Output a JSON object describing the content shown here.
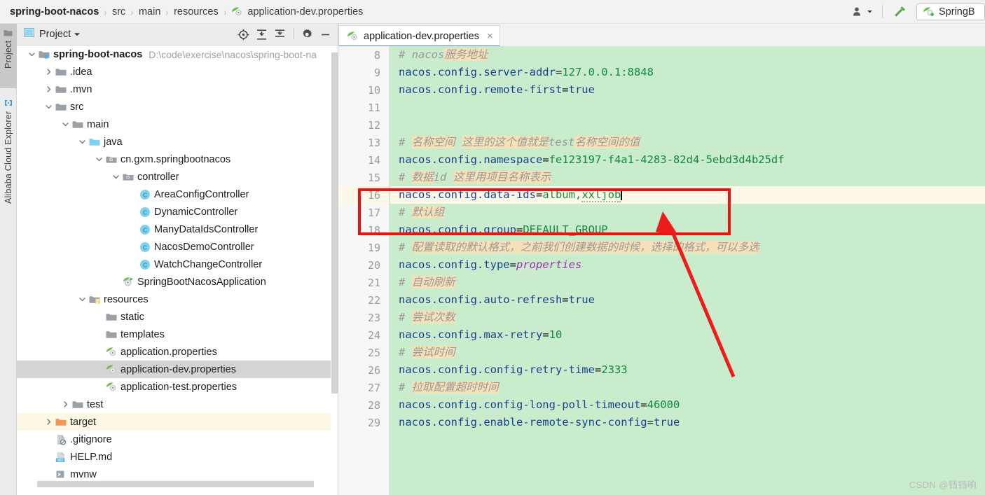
{
  "breadcrumb": {
    "items": [
      "spring-boot-nacos",
      "src",
      "main",
      "resources"
    ],
    "file": "application-dev.properties",
    "separator": "›"
  },
  "navbar_right": {
    "user_icon": "user-silhouette-icon",
    "dropdown_arrow": "chevron-down-icon",
    "build_icon": "hammer-icon",
    "run_config_label": "SpringB"
  },
  "toolstrip": {
    "tabs": [
      {
        "label": "Project",
        "icon": "folder-icon",
        "active": true
      },
      {
        "label": "Alibaba Cloud Explorer",
        "icon": "cloud-link-icon",
        "active": false
      }
    ]
  },
  "project_panel": {
    "title": "Project",
    "title_icon": "project-view-icon",
    "dropdown_icon": "chevron-down-icon",
    "actions": [
      {
        "name": "locate-icon",
        "title": "Select Opened File"
      },
      {
        "name": "expand-all-icon",
        "title": "Expand All"
      },
      {
        "name": "collapse-all-icon",
        "title": "Collapse All"
      },
      {
        "name": "gear-icon",
        "title": "Settings"
      },
      {
        "name": "minimize-icon",
        "title": "Hide"
      }
    ],
    "tree": [
      {
        "depth": 0,
        "twist": "down",
        "icon": "module-folder",
        "label": "spring-boot-nacos",
        "bold": true,
        "path": "D:\\code\\exercise\\nacos\\spring-boot-na"
      },
      {
        "depth": 1,
        "twist": "right",
        "icon": "folder",
        "label": ".idea"
      },
      {
        "depth": 1,
        "twist": "right",
        "icon": "folder",
        "label": ".mvn"
      },
      {
        "depth": 1,
        "twist": "down",
        "icon": "folder",
        "label": "src"
      },
      {
        "depth": 2,
        "twist": "down",
        "icon": "folder",
        "label": "main"
      },
      {
        "depth": 3,
        "twist": "down",
        "icon": "source-folder",
        "label": "java"
      },
      {
        "depth": 4,
        "twist": "down",
        "icon": "package",
        "label": "cn.gxm.springbootnacos"
      },
      {
        "depth": 5,
        "twist": "down",
        "icon": "package",
        "label": "controller"
      },
      {
        "depth": 6,
        "twist": "none",
        "icon": "class",
        "label": "AreaConfigController"
      },
      {
        "depth": 6,
        "twist": "none",
        "icon": "class",
        "label": "DynamicController"
      },
      {
        "depth": 6,
        "twist": "none",
        "icon": "class",
        "label": "ManyDataIdsController"
      },
      {
        "depth": 6,
        "twist": "none",
        "icon": "class",
        "label": "NacosDemoController"
      },
      {
        "depth": 6,
        "twist": "none",
        "icon": "class",
        "label": "WatchChangeController"
      },
      {
        "depth": 5,
        "twist": "none",
        "icon": "spring-class",
        "label": "SpringBootNacosApplication"
      },
      {
        "depth": 3,
        "twist": "down",
        "icon": "resource-folder",
        "label": "resources"
      },
      {
        "depth": 4,
        "twist": "none",
        "icon": "folder",
        "label": "static"
      },
      {
        "depth": 4,
        "twist": "none",
        "icon": "folder",
        "label": "templates"
      },
      {
        "depth": 4,
        "twist": "none",
        "icon": "nacos-file",
        "label": "application.properties"
      },
      {
        "depth": 4,
        "twist": "none",
        "icon": "nacos-file",
        "label": "application-dev.properties",
        "state": "sel"
      },
      {
        "depth": 4,
        "twist": "none",
        "icon": "nacos-file",
        "label": "application-test.properties"
      },
      {
        "depth": 2,
        "twist": "right",
        "icon": "folder",
        "label": "test"
      },
      {
        "depth": 1,
        "twist": "right",
        "icon": "target-folder",
        "label": "target",
        "state": "hl"
      },
      {
        "depth": 1,
        "twist": "none",
        "icon": "gitignore",
        "label": ".gitignore"
      },
      {
        "depth": 1,
        "twist": "none",
        "icon": "markdown",
        "label": "HELP.md"
      },
      {
        "depth": 1,
        "twist": "none",
        "icon": "shell",
        "label": "mvnw"
      }
    ]
  },
  "editor": {
    "tab": {
      "label": "application-dev.properties",
      "icon": "nacos-file",
      "close": "×"
    },
    "current_line": 16,
    "caret_line": 16,
    "lines": [
      {
        "n": 8,
        "segments": [
          {
            "t": "# ",
            "c": "cmt"
          },
          {
            "t": "nacos",
            "c": "cmt"
          },
          {
            "t": "服务地址",
            "c": "cmt cmt-hl"
          }
        ]
      },
      {
        "n": 9,
        "segments": [
          {
            "t": "nacos.config.server-addr",
            "c": "k"
          },
          {
            "t": "=",
            "c": "eq"
          },
          {
            "t": "127.0.0.1:8848",
            "c": "v"
          }
        ]
      },
      {
        "n": 10,
        "segments": [
          {
            "t": "nacos.config.remote-first",
            "c": "k"
          },
          {
            "t": "=",
            "c": "eq"
          },
          {
            "t": "true",
            "c": "k"
          }
        ]
      },
      {
        "n": 11,
        "segments": []
      },
      {
        "n": 12,
        "segments": []
      },
      {
        "n": 13,
        "segments": [
          {
            "t": "# ",
            "c": "cmt"
          },
          {
            "t": "名称空间",
            "c": "cmt cmt-hl"
          },
          {
            "t": " ",
            "c": "cmt"
          },
          {
            "t": "这里的这个值就是",
            "c": "cmt cmt-hl"
          },
          {
            "t": "test",
            "c": "cmt"
          },
          {
            "t": "名称空间的值",
            "c": "cmt cmt-hl"
          }
        ]
      },
      {
        "n": 14,
        "segments": [
          {
            "t": "nacos.config.namespace",
            "c": "k"
          },
          {
            "t": "=",
            "c": "eq"
          },
          {
            "t": "fe123197-f4a1-4283-82d4-5ebd3d4b25df",
            "c": "v"
          }
        ]
      },
      {
        "n": 15,
        "segments": [
          {
            "t": "# ",
            "c": "cmt"
          },
          {
            "t": "数据",
            "c": "cmt cmt-hl"
          },
          {
            "t": "id",
            "c": "cmt"
          },
          {
            "t": " ",
            "c": "cmt"
          },
          {
            "t": "这里用项目名称表示",
            "c": "cmt cmt-hl"
          }
        ]
      },
      {
        "n": 16,
        "segments": [
          {
            "t": "nacos.config.data-ids",
            "c": "k"
          },
          {
            "t": "=",
            "c": "eq"
          },
          {
            "t": "album,",
            "c": "v"
          },
          {
            "t": "xxljob",
            "c": "v squig"
          }
        ],
        "caret": true
      },
      {
        "n": 17,
        "segments": [
          {
            "t": "# ",
            "c": "cmt"
          },
          {
            "t": "默认组",
            "c": "cmt cmt-hl"
          }
        ]
      },
      {
        "n": 18,
        "segments": [
          {
            "t": "nacos.config.group",
            "c": "k"
          },
          {
            "t": "=",
            "c": "eq"
          },
          {
            "t": "DEFAULT_GROUP",
            "c": "v"
          }
        ]
      },
      {
        "n": 19,
        "segments": [
          {
            "t": "# ",
            "c": "cmt"
          },
          {
            "t": "配置读取的默认格式，之前我们创建数据的时候，选择的格式，可以多选",
            "c": "cmt cmt-hl"
          }
        ]
      },
      {
        "n": 20,
        "segments": [
          {
            "t": "nacos.config.type",
            "c": "k"
          },
          {
            "t": "=",
            "c": "eq"
          },
          {
            "t": "properties",
            "c": "vprop"
          }
        ]
      },
      {
        "n": 21,
        "segments": [
          {
            "t": "# ",
            "c": "cmt"
          },
          {
            "t": "自动刷新",
            "c": "cmt cmt-hl"
          }
        ]
      },
      {
        "n": 22,
        "segments": [
          {
            "t": "nacos.config.auto-refresh",
            "c": "k"
          },
          {
            "t": "=",
            "c": "eq"
          },
          {
            "t": "true",
            "c": "k"
          }
        ]
      },
      {
        "n": 23,
        "segments": [
          {
            "t": "# ",
            "c": "cmt"
          },
          {
            "t": "尝试次数",
            "c": "cmt cmt-hl"
          }
        ]
      },
      {
        "n": 24,
        "segments": [
          {
            "t": "nacos.config.max-retry",
            "c": "k"
          },
          {
            "t": "=",
            "c": "eq"
          },
          {
            "t": "10",
            "c": "v"
          }
        ]
      },
      {
        "n": 25,
        "segments": [
          {
            "t": "# ",
            "c": "cmt"
          },
          {
            "t": "尝试时间",
            "c": "cmt cmt-hl"
          }
        ]
      },
      {
        "n": 26,
        "segments": [
          {
            "t": "nacos.config.config-retry-time",
            "c": "k"
          },
          {
            "t": "=",
            "c": "eq"
          },
          {
            "t": "2333",
            "c": "v"
          }
        ]
      },
      {
        "n": 27,
        "segments": [
          {
            "t": "# ",
            "c": "cmt"
          },
          {
            "t": "拉取配置超时时间",
            "c": "cmt cmt-hl"
          }
        ]
      },
      {
        "n": 28,
        "segments": [
          {
            "t": "nacos.config.config-long-poll-timeout",
            "c": "k"
          },
          {
            "t": "=",
            "c": "eq"
          },
          {
            "t": "46000",
            "c": "v"
          }
        ]
      },
      {
        "n": 29,
        "segments": [
          {
            "t": "nacos.config.enable-remote-sync-config",
            "c": "k"
          },
          {
            "t": "=",
            "c": "eq"
          },
          {
            "t": "true",
            "c": "k"
          }
        ]
      }
    ]
  },
  "annotation": {
    "rect_color": "#f01010",
    "arrow_color": "#ee1b1b"
  },
  "watermark": "CSDN @铛铛响",
  "colors": {
    "vcs_modified_bg": "#c8eccc",
    "current_line_bg": "#fdf8e8",
    "gutter_bg": "#f7f7f7",
    "chrome_bg": "#f2f2f2",
    "selection_bg": "#d4d4d4",
    "key_blue": "#1b3f8f",
    "value_green": "#138a3c",
    "comment_gray": "#9a9a9a",
    "comment_hl": "#f5e0b8",
    "tab_underline": "#4a86c8"
  }
}
